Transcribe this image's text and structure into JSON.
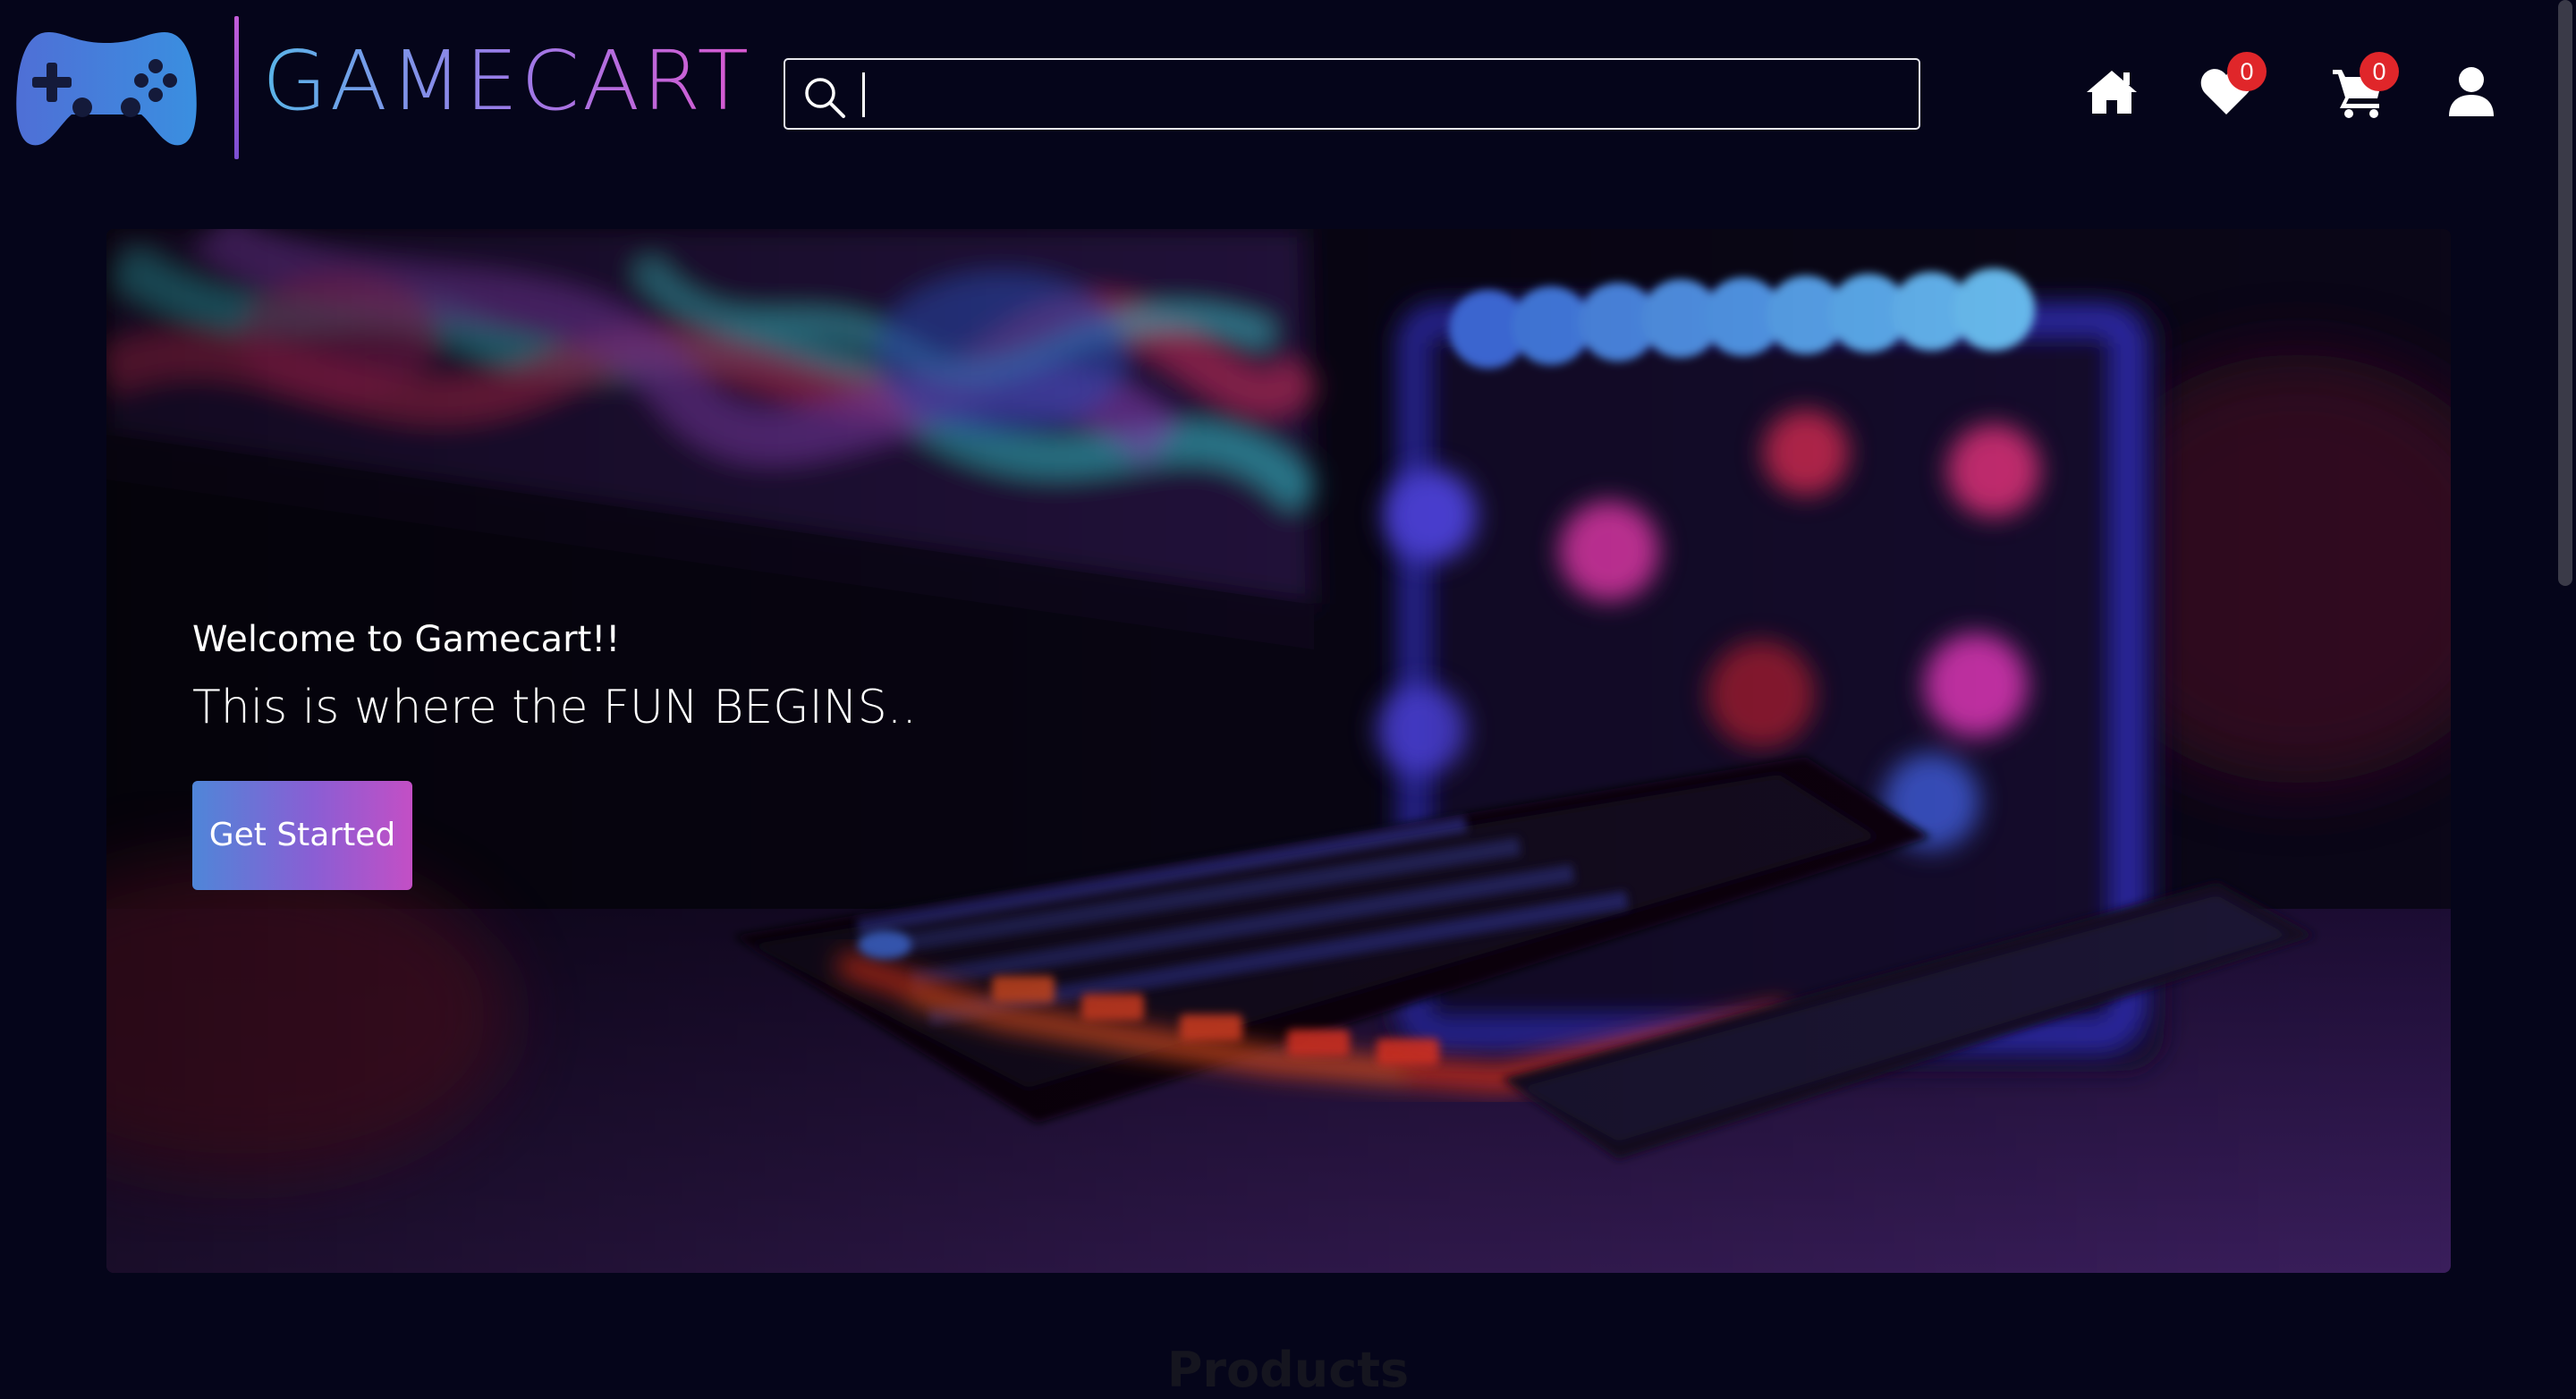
{
  "header": {
    "logo_text": "GAMECART",
    "search": {
      "value": "",
      "placeholder": ""
    },
    "nav": {
      "home_icon": "home-icon",
      "wishlist_icon": "heart-icon",
      "cart_icon": "cart-icon",
      "user_icon": "user-icon",
      "wishlist_count": "0",
      "cart_count": "0"
    }
  },
  "hero": {
    "welcome": "Welcome to Gamecart!!",
    "tagline": "This is where the FUN BEGINS..",
    "button_label": "Get Started"
  },
  "section": {
    "title": "Products"
  },
  "colors": {
    "background": "#05051a",
    "accent_gradient_start": "#4f86d8",
    "accent_gradient_end": "#c34fc5",
    "badge": "#e0262a"
  }
}
